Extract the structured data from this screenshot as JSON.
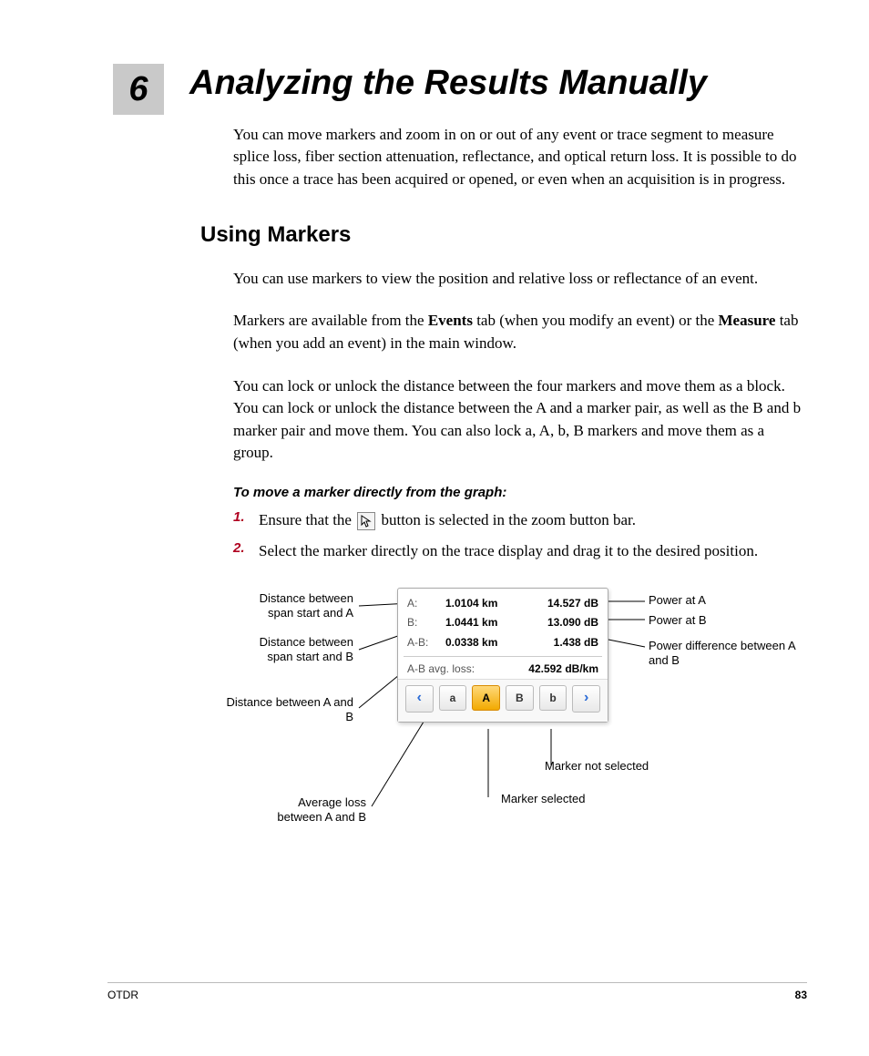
{
  "chapter": {
    "number": "6",
    "title": "Analyzing the Results Manually"
  },
  "intro": "You can move markers and zoom in on or out of any event or trace segment to measure splice loss, fiber section attenuation, reflectance, and optical return loss. It is possible to do this once a trace has been acquired or opened, or even when an acquisition is in progress.",
  "section": {
    "heading": "Using Markers",
    "p1": "You can use markers to view the position and relative loss or reflectance of an event.",
    "p2_pre": "Markers are available from the ",
    "p2_bold1": "Events",
    "p2_mid": " tab (when you modify an event) or the ",
    "p2_bold2": "Measure",
    "p2_post": " tab (when you add an event) in the main window.",
    "p3": "You can lock or unlock the distance between the four markers and move them as a block. You can lock or unlock the distance between the A and a marker pair, as well as the B and b marker pair and move them. You can also lock a, A, b, B markers and move them as a group."
  },
  "procedure": {
    "heading": "To move a marker directly from the graph:",
    "step1_num": "1.",
    "step1_pre": "Ensure that the ",
    "step1_post": " button is selected in the zoom button bar.",
    "step2_num": "2.",
    "step2": "Select the marker directly on the trace display and drag it to the desired position."
  },
  "panel": {
    "rows": {
      "A": {
        "label": "A:",
        "dist": "1.0104 km",
        "pow": "14.527 dB"
      },
      "B": {
        "label": "B:",
        "dist": "1.0441 km",
        "pow": "13.090 dB"
      },
      "AB": {
        "label": "A-B:",
        "dist": "0.0338 km",
        "pow": "1.438 dB"
      }
    },
    "avg": {
      "label": "A-B avg. loss:",
      "value": "42.592 dB/km"
    },
    "buttons": {
      "left": "‹",
      "a": "a",
      "A": "A",
      "B": "B",
      "b": "b",
      "right": "›"
    }
  },
  "callouts": {
    "distA": "Distance between span start and A",
    "distB": "Distance between span start and B",
    "distAB": "Distance between A and B",
    "avgloss": "Average loss between A and B",
    "powA": "Power at A",
    "powB": "Power at B",
    "powDiff": "Power difference between A and B",
    "mSel": "Marker selected",
    "mNotSel": "Marker not selected"
  },
  "footer": {
    "doc": "OTDR",
    "page": "83"
  }
}
